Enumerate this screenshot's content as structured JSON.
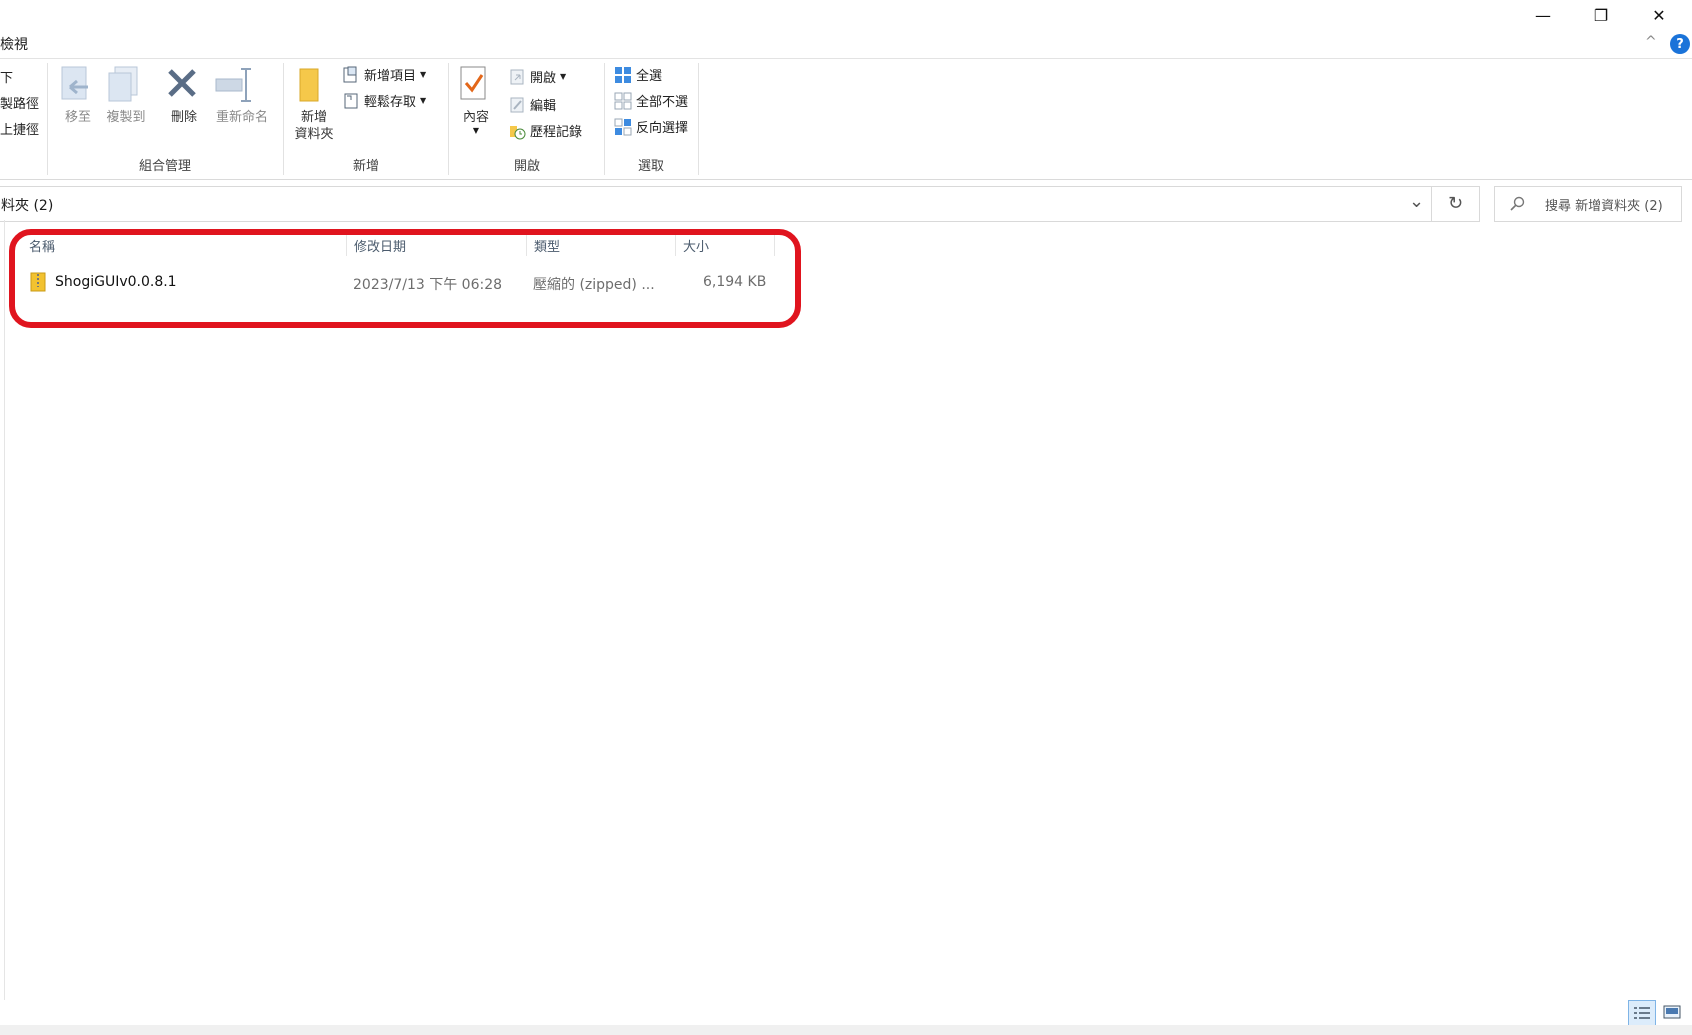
{
  "title_bar": {
    "tab_label": "檢視",
    "minimize_glyph": "—",
    "restore_glyph": "❐",
    "close_glyph": "✕"
  },
  "ribbon": {
    "clipboard_partial": {
      "item1": "下",
      "item2": "製路徑",
      "item3": "上捷徑"
    },
    "organize": {
      "move_to": "移至",
      "copy_to": "複製到",
      "delete": "刪除",
      "rename": "重新命名",
      "group_label": "組合管理"
    },
    "new": {
      "new_folder_line1": "新增",
      "new_folder_line2": "資料夾",
      "new_item": "新增項目",
      "easy_access": "輕鬆存取",
      "group_label": "新增"
    },
    "open": {
      "properties": "內容",
      "open": "開啟",
      "edit": "編輯",
      "history": "歷程記錄",
      "group_label": "開啟"
    },
    "select": {
      "select_all": "全選",
      "select_none": "全部不選",
      "invert": "反向選擇",
      "group_label": "選取"
    },
    "help_glyph": "?",
    "collapse_glyph": "^"
  },
  "address": {
    "path": "料夾 (2)",
    "refresh_glyph": "↻",
    "dropdown_glyph": "⌄",
    "search_placeholder": "搜尋 新增資料夾 (2)"
  },
  "file_list": {
    "columns": [
      "名稱",
      "修改日期",
      "類型",
      "大小"
    ],
    "rows": [
      {
        "name": "ShogiGUIv0.0.8.1",
        "modified": "2023/7/13 下午 06:28",
        "type": "壓縮的 (zipped) ...",
        "size": "6,194 KB"
      }
    ]
  },
  "colors": {
    "highlight_border": "#e0141e",
    "accent_blue": "#1a73d9",
    "zip_yellow": "#f2c230"
  },
  "icons": [
    "minimize-icon",
    "restore-icon",
    "close-icon",
    "help-icon",
    "move-to-icon",
    "copy-to-icon",
    "delete-icon",
    "rename-icon",
    "new-folder-icon",
    "new-item-icon",
    "easy-access-icon",
    "properties-icon",
    "open-icon",
    "edit-icon",
    "history-icon",
    "select-all-icon",
    "select-none-icon",
    "invert-selection-icon",
    "refresh-icon",
    "search-icon",
    "zip-folder-icon",
    "details-view-icon",
    "large-icons-view-icon"
  ]
}
